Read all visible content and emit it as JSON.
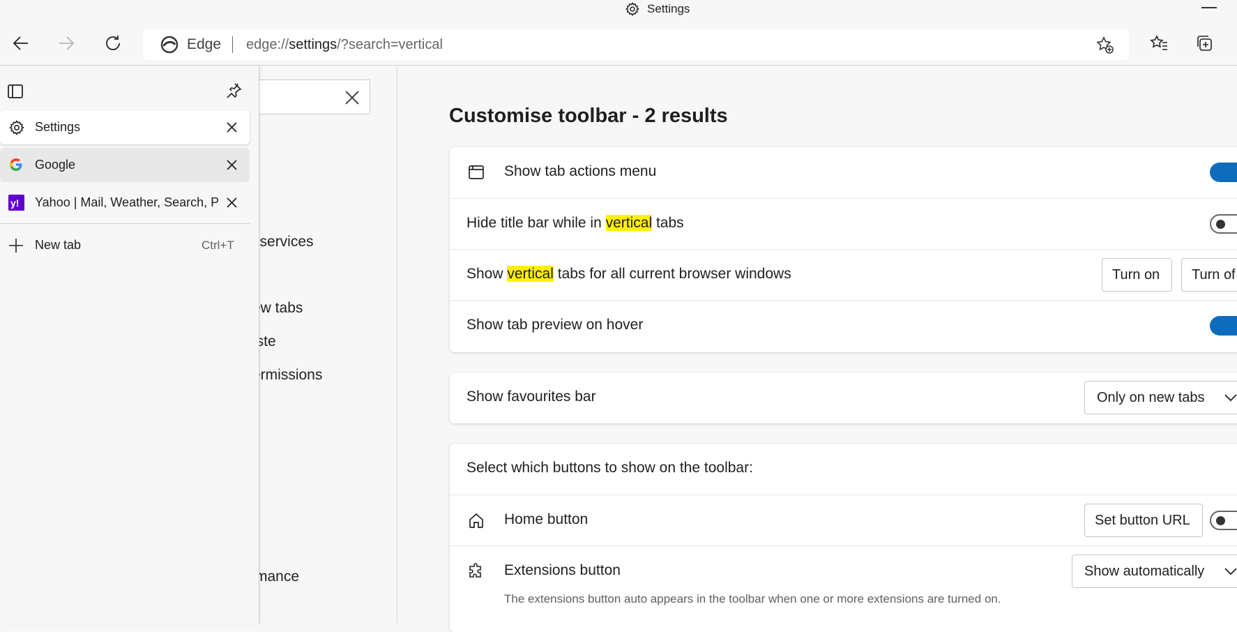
{
  "window": {
    "title": "Settings"
  },
  "toolbar": {
    "browser_label": "Edge",
    "url_prefix": "edge://",
    "url_host": "settings",
    "url_rest": "/?search=vertical"
  },
  "tabs_pane": {
    "tabs": [
      {
        "title": "Settings",
        "icon": "gear-icon"
      },
      {
        "title": "Google",
        "icon": "google-icon"
      },
      {
        "title": "Yahoo | Mail, Weather, Search, Politics, News, Finance, Sports & Videos",
        "icon": "yahoo-icon"
      }
    ],
    "new_tab": {
      "label": "New tab",
      "shortcut": "Ctrl+T"
    }
  },
  "settings_nav": {
    "visible_fragments": [
      "d services",
      "ew tabs",
      "iste",
      "ermissions",
      "mance"
    ]
  },
  "main": {
    "heading": "Customise toolbar - 2 results",
    "card1": {
      "rows": [
        {
          "label": "Show tab actions menu",
          "control": "toggle-on"
        },
        {
          "label_before": "Hide title bar while in ",
          "highlight": "vertical",
          "label_after": " tabs",
          "control": "toggle-off"
        },
        {
          "label_before": "Show ",
          "highlight": "vertical",
          "label_after": " tabs for all current browser windows",
          "button_on": "Turn on",
          "button_off": "Turn of"
        },
        {
          "label": "Show tab preview on hover",
          "control": "toggle-on"
        }
      ]
    },
    "card2": {
      "label": "Show favourites bar",
      "select_value": "Only on new tabs"
    },
    "card3": {
      "header": "Select which buttons to show on the toolbar:",
      "home": {
        "label": "Home button",
        "button": "Set button URL",
        "control": "toggle-off"
      },
      "extensions": {
        "label": "Extensions button",
        "select_value": "Show automatically",
        "description": "The extensions button auto appears in the toolbar when one or more extensions are turned on."
      }
    }
  },
  "colors": {
    "accent": "#0f6cbd",
    "highlight": "#fff100",
    "background": "#f7f7f7"
  }
}
